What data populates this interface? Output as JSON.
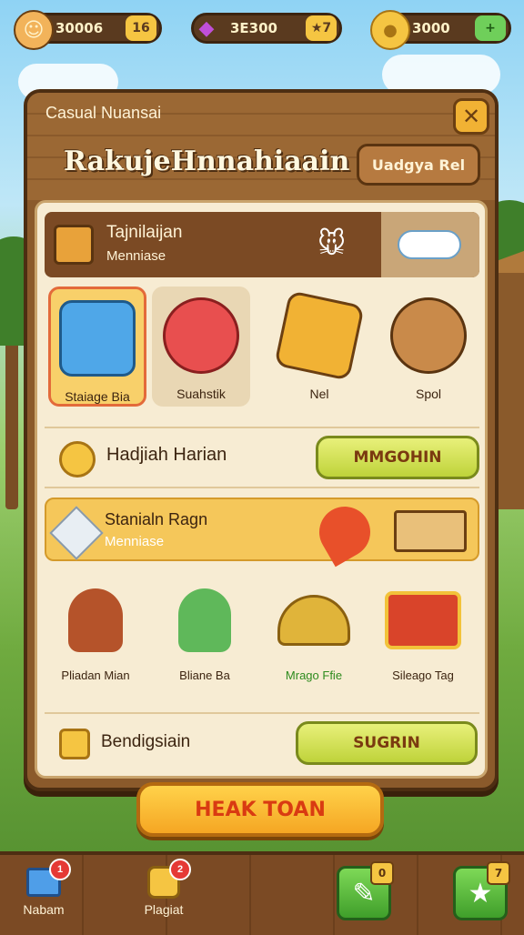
{
  "topbar": {
    "resources": [
      {
        "icon": "avatar-icon",
        "value": "30006",
        "badge": "16",
        "badge_color": "#f5c542"
      },
      {
        "icon": "gem-icon",
        "value": "3E300",
        "badge": "7",
        "badge_color": "#f5c542"
      },
      {
        "icon": "coin-icon",
        "value": "3000",
        "badge": "+",
        "badge_color": "#6fcf5a"
      }
    ]
  },
  "panel": {
    "subtitle": "Casual Nuansai",
    "title": "RakujeHnnahiaain",
    "header_button": "Uadgya Rel",
    "close": "✕",
    "banner": {
      "title": "Tajnilaijan",
      "subtitle": "Menniase"
    },
    "items": [
      {
        "label": "Staiage Bia",
        "icon": "blue-gem-icon",
        "color": "#4fa7e8"
      },
      {
        "label": "Suahstik",
        "icon": "red-orb-icon",
        "color": "#e84f4f"
      },
      {
        "label": "Nel",
        "icon": "card-icon",
        "color": "#f1b234"
      },
      {
        "label": "Spol",
        "icon": "monkey-icon",
        "color": "#c98a4a"
      }
    ],
    "daily": {
      "label": "Hadjiah Harian",
      "button": "MMGOHIN"
    },
    "banner2": {
      "title": "Stanialn Ragn",
      "subtitle": "Menniase"
    },
    "rewards": [
      {
        "label": "Pliadan Mian",
        "icon": "monkey-coin-icon",
        "color": "#3c2410"
      },
      {
        "label": "Bliane Ba",
        "icon": "elf-icon",
        "color": "#3c2410"
      },
      {
        "label": "Mrago Ffie",
        "icon": "gold-pile-icon",
        "color": "#2e8b1e"
      },
      {
        "label": "Sileago Tag",
        "icon": "treasure-chest-icon",
        "color": "#3c2410"
      }
    ],
    "bottom": {
      "label": "Bendigsiain",
      "button": "SUGRIN"
    }
  },
  "main_button": "HEAK TOAN",
  "nav": {
    "left": [
      {
        "label": "Nabam",
        "icon": "home-icon",
        "badge": "1"
      },
      {
        "label": "Plagiat",
        "icon": "puzzle-icon",
        "badge": "2"
      }
    ],
    "right": [
      {
        "icon": "pencil-icon",
        "badge": "0"
      },
      {
        "icon": "star-icon",
        "badge": "7"
      }
    ]
  }
}
